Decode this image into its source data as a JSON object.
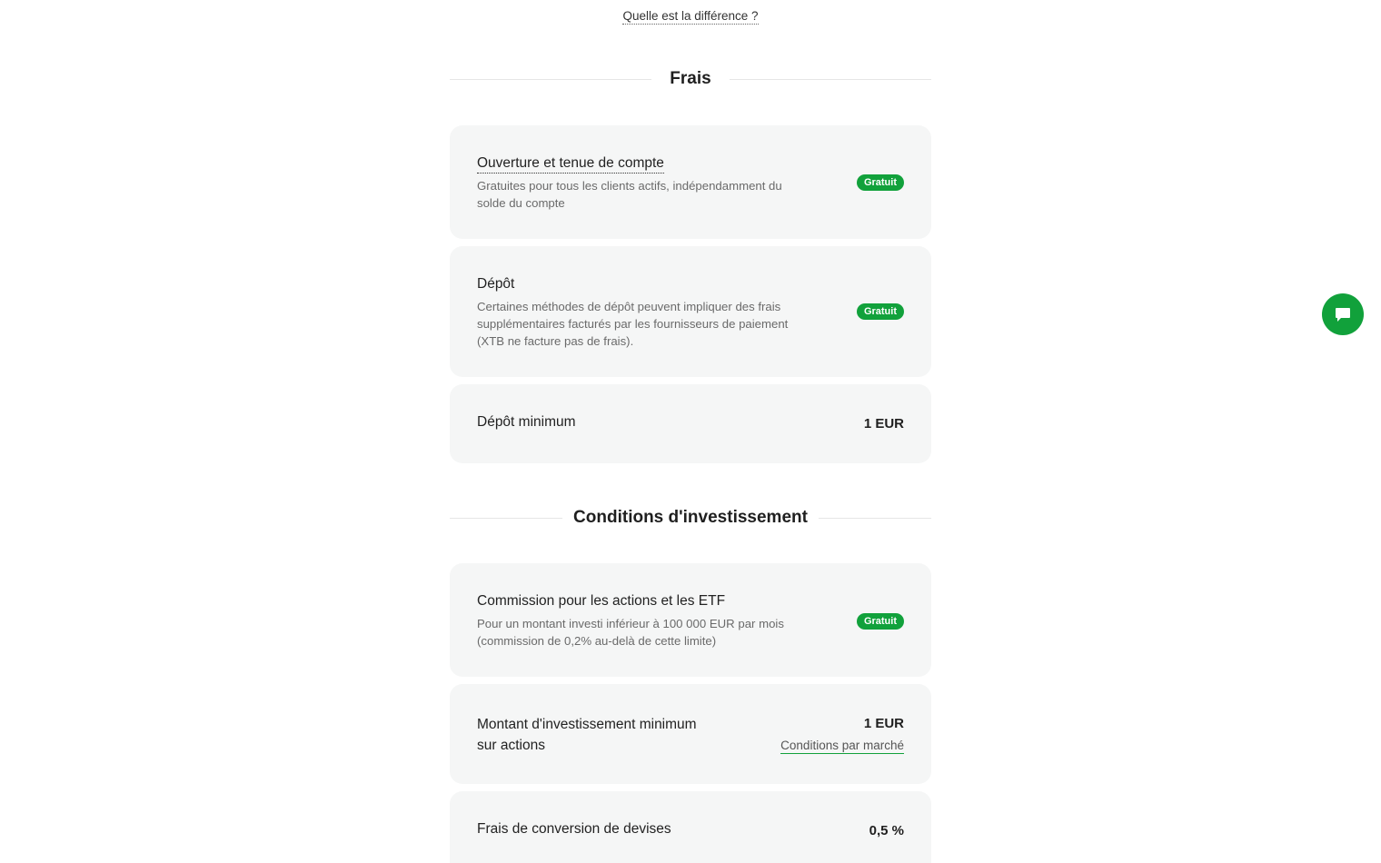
{
  "top_link": "Quelle est la différence ?",
  "fees": {
    "heading": "Frais",
    "cards": [
      {
        "title": "Ouverture et tenue de compte",
        "desc": "Gratuites pour tous les clients actifs, indépendamment du solde du compte",
        "badge": "Gratuit"
      },
      {
        "title": "Dépôt",
        "desc": "Certaines méthodes de dépôt peuvent impliquer des frais supplémentaires facturés par les fournisseurs de paiement (XTB ne facture pas de frais).",
        "badge": "Gratuit"
      },
      {
        "title": "Dépôt minimum",
        "value": "1 EUR"
      }
    ]
  },
  "investment": {
    "heading": "Conditions d'investissement",
    "cards": [
      {
        "title": "Commission pour les actions et les ETF",
        "desc": "Pour un montant investi inférieur à 100 000 EUR par mois (commission de 0,2% au-delà de cette limite)",
        "badge": "Gratuit"
      },
      {
        "title_line1": "Montant d'investissement minimum",
        "title_line2": "sur actions",
        "value": "1 EUR",
        "link": "Conditions par marché"
      },
      {
        "title": "Frais de conversion de devises",
        "value": "0,5 %"
      }
    ]
  },
  "chat": {
    "icon": "chat-bubble-icon"
  },
  "colors": {
    "accent": "#11a13b",
    "card_bg": "#f5f6f6"
  }
}
